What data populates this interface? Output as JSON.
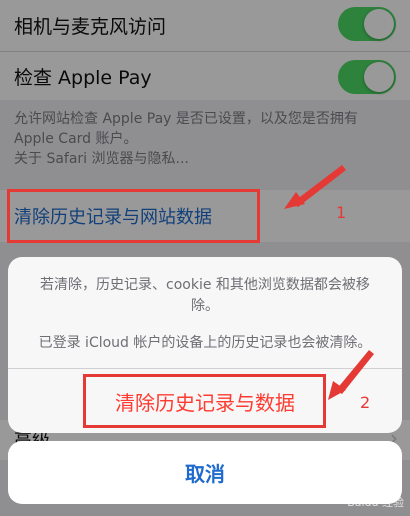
{
  "settings": {
    "camera_mic_label": "相机与麦克风访问",
    "apple_pay_label": "检查 Apple Pay",
    "apple_pay_desc_line1": "允许网站检查 Apple Pay 是否已设置，以及您是否拥有",
    "apple_pay_desc_line2": "Apple Card 账户。",
    "privacy_link": "关于 Safari 浏览器与隐私...",
    "clear_history_label": "清除历史记录与网站数据",
    "advanced_label": "高级"
  },
  "sheet": {
    "message1": "若清除，历史记录、cookie 和其他浏览数据都会被移除。",
    "message2": "已登录 iCloud 帐户的设备上的历史记录也会被清除。",
    "action_label": "清除历史记录与数据",
    "cancel_label": "取消"
  },
  "annotations": {
    "step1": "1",
    "step2": "2"
  },
  "colors": {
    "toggle_on": "#4cd964",
    "link_blue": "#1f6bcd",
    "destructive_red": "#ff3b30",
    "annotation_red": "#e53935"
  },
  "watermark": "Baidu 经验"
}
